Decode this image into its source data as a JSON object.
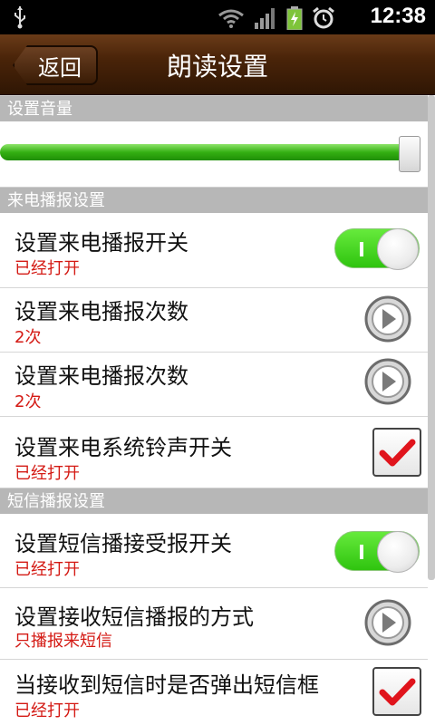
{
  "status_bar": {
    "time": "12:38",
    "icons": [
      "usb-icon",
      "wifi-icon",
      "signal-icon",
      "battery-icon",
      "alarm-icon"
    ]
  },
  "header": {
    "back_label": "返回",
    "title": "朗读设置"
  },
  "volume": {
    "section_title": "设置音量",
    "level": 0.97
  },
  "call_section": {
    "title": "来电播报设置",
    "items": [
      {
        "label": "设置来电播报开关",
        "value": "已经打开",
        "control": "toggle",
        "on": true
      },
      {
        "label": "设置来电播报次数",
        "value": "2次",
        "control": "arrow"
      },
      {
        "label": "设置来电播报次数",
        "value": "2次",
        "control": "arrow"
      },
      {
        "label": "设置来电系统铃声开关",
        "value": "已经打开",
        "control": "checkbox",
        "checked": true
      }
    ]
  },
  "sms_section": {
    "title": "短信播报设置",
    "items": [
      {
        "label": "设置短信播接受报开关",
        "value": "已经打开",
        "control": "toggle",
        "on": true
      },
      {
        "label": "设置接收短信播报的方式",
        "value": "只播报来短信",
        "control": "arrow"
      },
      {
        "label": "当接收到短信时是否弹出短信框",
        "value": "已经打开",
        "control": "checkbox",
        "checked": true
      }
    ]
  },
  "colors": {
    "accent_green": "#34b013",
    "value_red": "#d41a14",
    "header_brown": "#4a2409",
    "section_gray": "#b7b7b7"
  }
}
